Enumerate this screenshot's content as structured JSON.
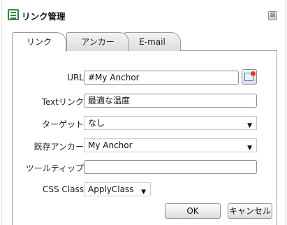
{
  "dialog": {
    "title": "リンク管理",
    "close_glyph": "⊠"
  },
  "tabs": [
    {
      "label": "リンク",
      "active": true
    },
    {
      "label": "アンカー",
      "active": false
    },
    {
      "label": "E-mail",
      "active": false
    }
  ],
  "form": {
    "url_label": "URL",
    "url_value": "#My Anchor",
    "text_link_label": "Textリンク",
    "text_link_value": "最適な温度",
    "target_label": "ターゲット",
    "target_value": "なし",
    "existing_anchor_label": "既存アンカー",
    "existing_anchor_value": "My Anchor",
    "tooltip_label": "ツールティップ",
    "tooltip_value": "",
    "css_class_label": "CSS Class",
    "css_class_value": "ApplyClass",
    "dropdown_glyph": "▼"
  },
  "buttons": {
    "ok": "OK",
    "cancel": "キャンセル"
  },
  "colors": {
    "icon_green": "#2e8a3a",
    "border": "#9a9a9a"
  }
}
